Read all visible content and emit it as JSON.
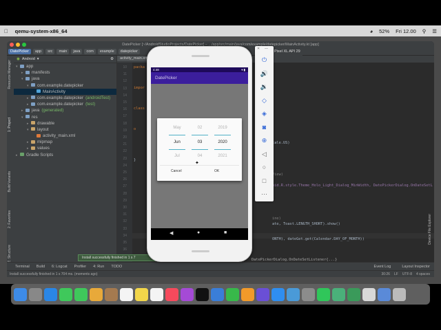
{
  "menubar": {
    "app_name": "qemu-system-x86_64",
    "battery": "52%",
    "clock": "Fri 12.00"
  },
  "ide": {
    "window_title": "DatePicker [~/AndroidStudioProjects/DatePicker] – .../app/src/main/java/com/example/datepicker/MainActivity.kt [app]",
    "breadcrumbs": [
      "DatePicker",
      "app",
      "src",
      "main",
      "java",
      "com",
      "example",
      "datepicker"
    ],
    "device_selector": "Pixel XL API 29",
    "project_view": "Android",
    "editor_tab": "activity_main.xml",
    "tree": [
      {
        "label": "app",
        "level": 0,
        "arrow": "▾",
        "color": "#7e9fc3"
      },
      {
        "label": "manifests",
        "level": 1,
        "arrow": "▸",
        "color": "#7e9fc3"
      },
      {
        "label": "java",
        "level": 1,
        "arrow": "▾",
        "color": "#7e9fc3"
      },
      {
        "label": "com.example.datepicker",
        "level": 2,
        "arrow": "▾",
        "color": "#7e9fc3"
      },
      {
        "label": "MainActivity",
        "level": 3,
        "arrow": "",
        "color": "#4fa3d8",
        "selected": true
      },
      {
        "label": "com.example.datepicker",
        "suffix": "(androidTest)",
        "level": 2,
        "arrow": "▸",
        "color": "#7e9fc3"
      },
      {
        "label": "com.example.datepicker",
        "suffix": "(test)",
        "level": 2,
        "arrow": "▸",
        "color": "#7e9fc3"
      },
      {
        "label": "java",
        "suffix": "(generated)",
        "level": 1,
        "arrow": "▸",
        "color": "#7e9fc3"
      },
      {
        "label": "res",
        "level": 1,
        "arrow": "▾",
        "color": "#7e9fc3"
      },
      {
        "label": "drawable",
        "level": 2,
        "arrow": "▸",
        "color": "#c9a46a"
      },
      {
        "label": "layout",
        "level": 2,
        "arrow": "▾",
        "color": "#c9a46a"
      },
      {
        "label": "activity_main.xml",
        "level": 3,
        "arrow": "",
        "color": "#e07a3a"
      },
      {
        "label": "mipmap",
        "level": 2,
        "arrow": "▸",
        "color": "#c9a46a"
      },
      {
        "label": "values",
        "level": 2,
        "arrow": "▸",
        "color": "#c9a46a"
      },
      {
        "label": "Gradle Scripts",
        "level": 0,
        "arrow": "▸",
        "color": "#6aa06a"
      }
    ],
    "left_tools": [
      "Resource Manager",
      "1: Project",
      "Build Variants",
      "2: Favorites",
      "Z: Structure"
    ],
    "right_tools": [
      "Device File Explorer"
    ],
    "line_numbers": [
      "10",
      "11",
      "12",
      "13",
      "14",
      "15",
      "16",
      "17",
      "18",
      "19",
      "20",
      "21",
      "22",
      "23",
      "24",
      "25",
      "26",
      "27",
      "28",
      "29",
      "30",
      "31",
      "32",
      "33",
      "34",
      "35",
      "36"
    ],
    "code_lines": [
      {
        "text": "packa",
        "kind": "kw"
      },
      {
        "text": "",
        "kind": ""
      },
      {
        "text": "impor",
        "kind": "kw"
      },
      {
        "text": "",
        "kind": ""
      },
      {
        "text": "class",
        "kind": "kw"
      },
      {
        "text": "",
        "kind": ""
      },
      {
        "text": "o",
        "kind": "kw"
      },
      {
        "text": "",
        "kind": ""
      },
      {
        "text": "",
        "kind": ""
      },
      {
        "text": "}",
        "kind": ""
      }
    ],
    "code_fragments": {
      "locale": "cale.US)",
      "view": "View)",
      "style_call": "oid.R.style.Theme_Holo_Light_Dialog_MinWidth, DatePickerDialog.OnDateSetL",
      "line_fn": "ine)",
      "toast": "ate, Toast.LENGTH_SHORT).show()",
      "month": "ONTH), dateGet.get(Calendar.DAY_OF_MONTH))",
      "listener": "DatePickerDialog.OnDateSetListener{...}"
    },
    "bottom_tabs": [
      "Terminal",
      "Build",
      "6: Logcat",
      "Profiler",
      "4: Run",
      "TODO"
    ],
    "bottom_right_tabs": [
      "Event Log",
      "Layout Inspector"
    ],
    "notification": "Install successfully finished in 1 s 7",
    "status_left": "Install successfully finished in 1 s 704 ms. (moments ago)",
    "status_right": [
      "30:26",
      "LF",
      "UTF-8",
      "4 spaces"
    ]
  },
  "phone": {
    "time": "4:48",
    "app_title": "DatePicker",
    "dialog": {
      "months": [
        "May",
        "Jun",
        "Jul"
      ],
      "days": [
        "02",
        "03",
        "04"
      ],
      "years": [
        "2019",
        "2020",
        "2021"
      ],
      "cancel": "Cancel",
      "ok": "OK"
    }
  },
  "emulator_toolbar": [
    "power-icon",
    "volume-up-icon",
    "volume-down-icon",
    "rotate-left-icon",
    "rotate-right-icon",
    "camera-icon",
    "zoom-icon",
    "back-icon",
    "home-icon",
    "overview-icon",
    "more-icon"
  ],
  "dock": [
    {
      "name": "finder-icon",
      "color": "#3d8be8"
    },
    {
      "name": "launchpad-icon",
      "color": "#888"
    },
    {
      "name": "safari-icon",
      "color": "#2a86e6"
    },
    {
      "name": "messages-icon",
      "color": "#3fc85b"
    },
    {
      "name": "facetime-icon",
      "color": "#3fc85b"
    },
    {
      "name": "photos-icon",
      "color": "#e8a93a"
    },
    {
      "name": "contacts-icon",
      "color": "#a57a4f"
    },
    {
      "name": "calendar-icon",
      "color": "#f4f4f4"
    },
    {
      "name": "notes-icon",
      "color": "#f2d64a"
    },
    {
      "name": "reminders-icon",
      "color": "#f4f4f4"
    },
    {
      "name": "music-icon",
      "color": "#f64a5c"
    },
    {
      "name": "podcasts-icon",
      "color": "#a54ad6"
    },
    {
      "name": "tv-icon",
      "color": "#111"
    },
    {
      "name": "keynote-icon",
      "color": "#3a7ed8"
    },
    {
      "name": "numbers-icon",
      "color": "#38b94a"
    },
    {
      "name": "pages-icon",
      "color": "#f29a2a"
    },
    {
      "name": "imovie-icon",
      "color": "#6a4fd6"
    },
    {
      "name": "app-store-icon",
      "color": "#2f8ef0"
    },
    {
      "name": "xcode-icon",
      "color": "#4a9ad8"
    },
    {
      "name": "system-preferences-icon",
      "color": "#8c8c8c"
    },
    {
      "name": "whatsapp-icon",
      "color": "#30c65a"
    },
    {
      "name": "android-studio-icon",
      "color": "#4ab07a"
    },
    {
      "name": "qemu-icon",
      "color": "#3a9a5a"
    },
    {
      "name": "preview-icon",
      "color": "#d8d8d8"
    },
    {
      "name": "downloads-icon",
      "color": "#5a8ad8"
    },
    {
      "name": "trash-icon",
      "color": "#bbbbbb"
    }
  ]
}
